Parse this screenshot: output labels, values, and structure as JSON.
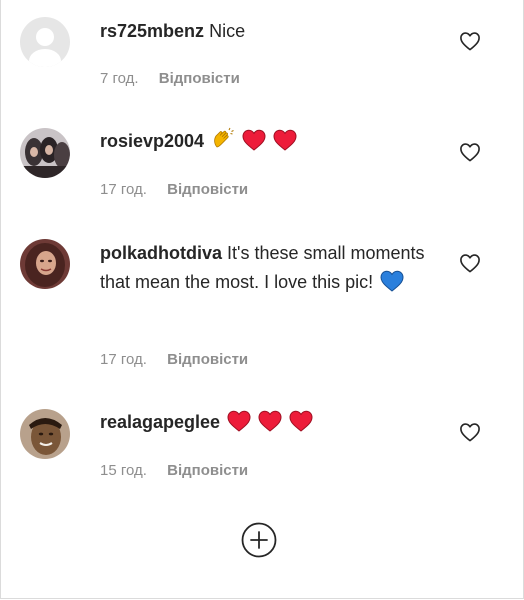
{
  "comments": [
    {
      "username": "rs725mbenz",
      "text": "Nice",
      "time": "7 год.",
      "reply_label": "Відповісти",
      "emojis": []
    },
    {
      "username": "rosievp2004",
      "text": "",
      "time": "17 год.",
      "reply_label": "Відповісти",
      "emojis": [
        "clapping-hands-emoji",
        "red-heart-emoji",
        "red-heart-emoji"
      ]
    },
    {
      "username": "polkadhotdiva",
      "text": "It's these small moments that mean the most. I love this pic!",
      "time": "17 год.",
      "reply_label": "Відповісти",
      "emojis": [
        "blue-heart-emoji"
      ]
    },
    {
      "username": "realagapeglee",
      "text": "",
      "time": "15 год.",
      "reply_label": "Відповісти",
      "emojis": [
        "red-heart-emoji",
        "red-heart-emoji",
        "red-heart-emoji"
      ]
    }
  ],
  "load_more": {
    "icon": "plus-circle-icon"
  },
  "colors": {
    "text": "#262626",
    "secondary": "#8e8e8e",
    "heart_red": "#ed1c3a",
    "heart_blue": "#2a7fdc"
  }
}
